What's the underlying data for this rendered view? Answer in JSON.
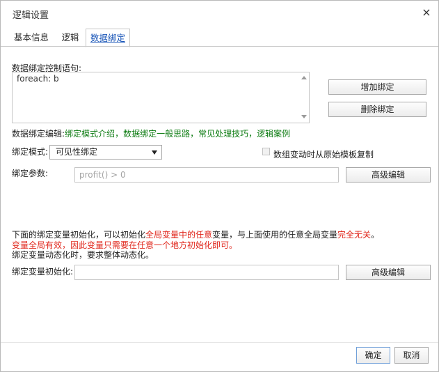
{
  "dialog": {
    "title": "逻辑设置",
    "close_glyph": "×"
  },
  "tabs": [
    {
      "label": "基本信息",
      "active": false
    },
    {
      "label": "逻辑",
      "active": false
    },
    {
      "label": "数据绑定",
      "active": true
    }
  ],
  "binding": {
    "statement_label": "数据绑定控制语句:",
    "statement_value": "foreach: b",
    "add_button": "增加绑定",
    "delete_button": "删除绑定",
    "edit_prefix": "数据绑定编辑:",
    "links": [
      "绑定模式介绍",
      "数据绑定一般思路",
      "常见处理技巧",
      "逻辑案例"
    ],
    "link_separator": "，",
    "mode_label": "绑定模式:",
    "mode_value": "可见性绑定",
    "copy_checkbox_label": "数组变动时从原始模板复制",
    "copy_checked": false,
    "params_label": "绑定参数:",
    "params_value": "profit() > 0",
    "params_advanced": "高级编辑"
  },
  "notes": {
    "line1_a": "下面的绑定变量初始化，可以初始化",
    "line1_b": "全局变量中的任意",
    "line1_c": "变量，与上面使用的任意全局变量",
    "line1_d": "完全无关",
    "line1_e": "。",
    "line2": "变量全局有效，因此变量只需要在任意一个地方初始化即可。",
    "line3": "绑定变量动态化时，要求整体动态化。"
  },
  "init": {
    "label": "绑定变量初始化:",
    "value": "",
    "advanced": "高级编辑"
  },
  "footer": {
    "ok": "确定",
    "cancel": "取消"
  },
  "colors": {
    "link": "#0e7c13",
    "warning": "#e0261b",
    "active_tab": "#1a56b8"
  }
}
